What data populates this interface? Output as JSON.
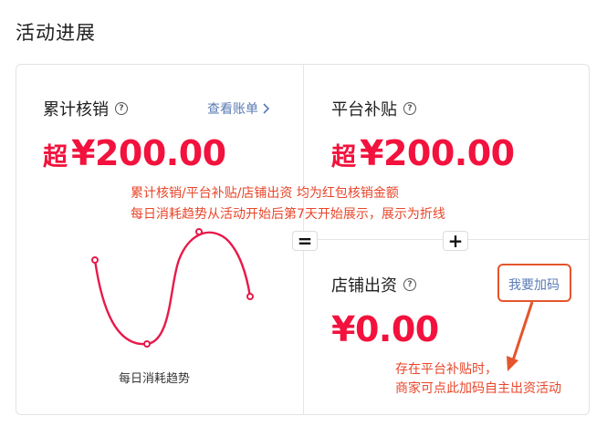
{
  "section_title": "活动进展",
  "panels": {
    "writeoff": {
      "label": "累计核销",
      "link": "查看账单",
      "amount_prefix": "超",
      "amount": "¥200.00"
    },
    "subsidy": {
      "label": "平台补贴",
      "amount_prefix": "超",
      "amount": "¥200.00"
    },
    "store": {
      "label": "店铺出资",
      "link": "我要加码",
      "amount": "¥0.00"
    }
  },
  "operators": {
    "equals": "=",
    "plus": "+"
  },
  "trend_caption": "每日消耗趋势",
  "annotations": {
    "line1": "累计核销/平台补贴/店铺出资 均为红包核销金额",
    "line2": "每日消耗趋势从活动开始后第7天开始展示，展示为折线",
    "note_line1": "存在平台补贴时，",
    "note_line2": "商家可点此加码自主出资活动"
  },
  "icons": {
    "help": "question-circle-icon",
    "chevron": "chevron-right-icon"
  },
  "colors": {
    "accent_red": "#f2123d",
    "annotation_red": "#e8462a",
    "link_blue": "#5a7bb5",
    "trend_line": "#e8194a"
  }
}
